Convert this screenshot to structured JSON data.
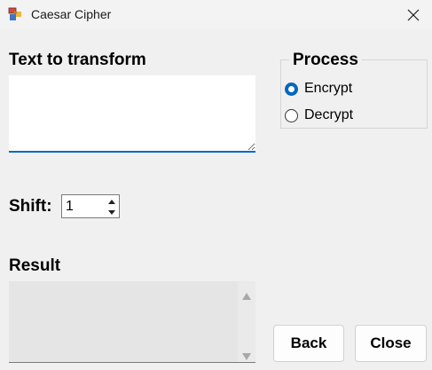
{
  "window": {
    "title": "Caesar Cipher"
  },
  "input": {
    "label": "Text to transform",
    "value": ""
  },
  "process": {
    "legend": "Process",
    "options": [
      {
        "label": "Encrypt",
        "checked": true
      },
      {
        "label": "Decrypt",
        "checked": false
      }
    ]
  },
  "shift": {
    "label": "Shift:",
    "value": "1"
  },
  "result": {
    "label": "Result",
    "value": ""
  },
  "buttons": {
    "back": "Back",
    "close": "Close"
  },
  "colors": {
    "accent": "#0067c0",
    "background": "#f0f0f0"
  },
  "icons": {
    "app": "app-window-icon",
    "close": "close-icon",
    "spin_up": "chevron-up-icon",
    "spin_down": "chevron-down-icon",
    "scroll_up": "scroll-up-arrow-icon",
    "scroll_down": "scroll-down-arrow-icon"
  }
}
